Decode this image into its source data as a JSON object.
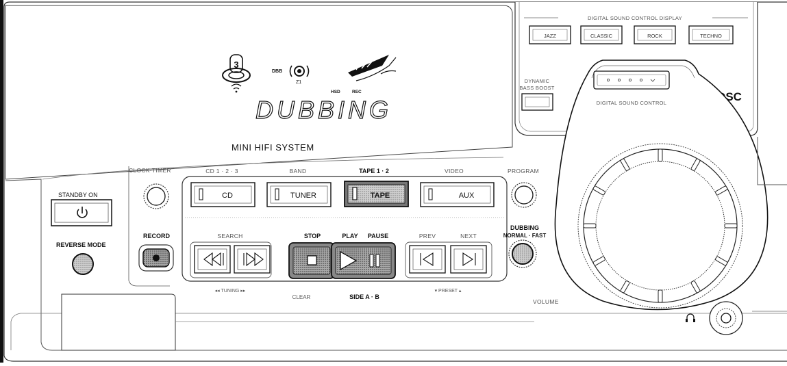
{
  "display": {
    "dbb_label": "DBB",
    "hsd_label": "HSD",
    "rec_label": "REC",
    "main_text": "DUBBING"
  },
  "product_label": "MINI HIFI SYSTEM",
  "left": {
    "standby_label": "STANDBY ON",
    "reverse_mode_label": "REVERSE MODE",
    "record_label": "RECORD",
    "clock_timer_label": "CLOCK·TIMER"
  },
  "sources": [
    {
      "top_label": "CD 1 · 2 · 3",
      "button": "CD"
    },
    {
      "top_label": "BAND",
      "button": "TUNER"
    },
    {
      "top_label": "TAPE 1 · 2",
      "button": "TAPE"
    },
    {
      "top_label": "VIDEO",
      "button": "AUX"
    }
  ],
  "transport": {
    "search_label": "SEARCH",
    "stop_label": "STOP",
    "play_label": "PLAY",
    "pause_label": "PAUSE",
    "prev_label": "PREV",
    "next_label": "NEXT",
    "tuning_label": "◂◂   TUNING   ▸▸",
    "preset_label": "▾   PRESET   ▴",
    "clear_label": "CLEAR",
    "side_label": "SIDE A · B"
  },
  "right_controls": {
    "program_label": "PROGRAM",
    "dubbing_label": "DUBBING",
    "dubbing_sub": "NORMAL · FAST",
    "volume_label": "VOLUME"
  },
  "dsc": {
    "display_title": "DIGITAL SOUND CONTROL DISPLAY",
    "presets": [
      "JAZZ",
      "CLASSIC",
      "ROCK",
      "TECHNO"
    ],
    "bass_line1": "DYNAMIC",
    "bass_line2": "BASS BOOST",
    "control_label": "DIGITAL SOUND CONTROL",
    "logo": "DSC"
  }
}
